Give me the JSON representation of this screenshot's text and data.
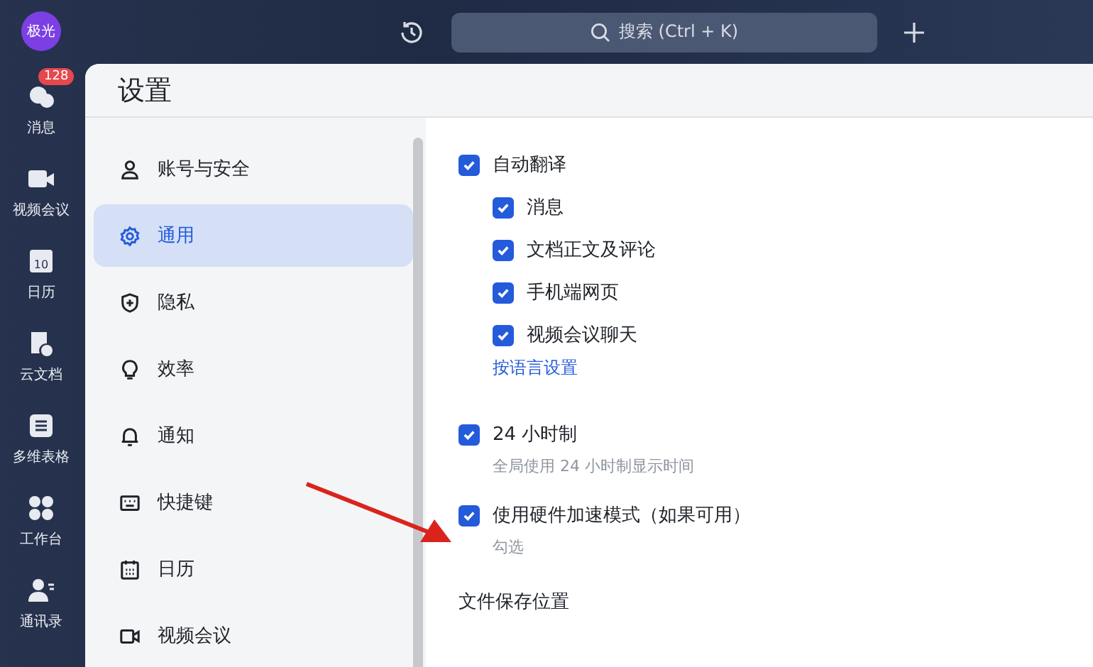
{
  "account": {
    "avatar_text": "极光"
  },
  "rail": [
    {
      "label": "消息",
      "badge": "128",
      "kind": "chat"
    },
    {
      "label": "视频会议",
      "kind": "video"
    },
    {
      "label": "日历",
      "kind": "calendar",
      "icon_text": "10"
    },
    {
      "label": "云文档",
      "kind": "docs"
    },
    {
      "label": "多维表格",
      "kind": "table"
    },
    {
      "label": "工作台",
      "kind": "apps"
    },
    {
      "label": "通讯录",
      "kind": "contacts"
    }
  ],
  "search": {
    "placeholder": "搜索 (Ctrl + K)"
  },
  "settings": {
    "title": "设置",
    "nav": [
      {
        "label": "账号与安全",
        "kind": "user",
        "selected": false
      },
      {
        "label": "通用",
        "kind": "gear",
        "selected": true
      },
      {
        "label": "隐私",
        "kind": "shield",
        "selected": false
      },
      {
        "label": "效率",
        "kind": "bulb",
        "selected": false
      },
      {
        "label": "通知",
        "kind": "bell",
        "selected": false
      },
      {
        "label": "快捷键",
        "kind": "keyboard",
        "selected": false
      },
      {
        "label": "日历",
        "kind": "calendar",
        "selected": false
      },
      {
        "label": "视频会议",
        "kind": "video",
        "selected": false
      }
    ],
    "auto_translate": {
      "label": "自动翻译",
      "checked": true,
      "options": [
        {
          "label": "消息",
          "checked": true
        },
        {
          "label": "文档正文及评论",
          "checked": true
        },
        {
          "label": "手机端网页",
          "checked": true
        },
        {
          "label": "视频会议聊天",
          "checked": true
        }
      ],
      "link": "按语言设置"
    },
    "clock_24h": {
      "label": "24 小时制",
      "checked": true,
      "hint": "全局使用 24 小时制显示时间"
    },
    "hardware_acceleration": {
      "label": "使用硬件加速模式（如果可用）",
      "checked": true,
      "hint": "勾选"
    },
    "file_location": {
      "title": "文件保存位置"
    }
  }
}
